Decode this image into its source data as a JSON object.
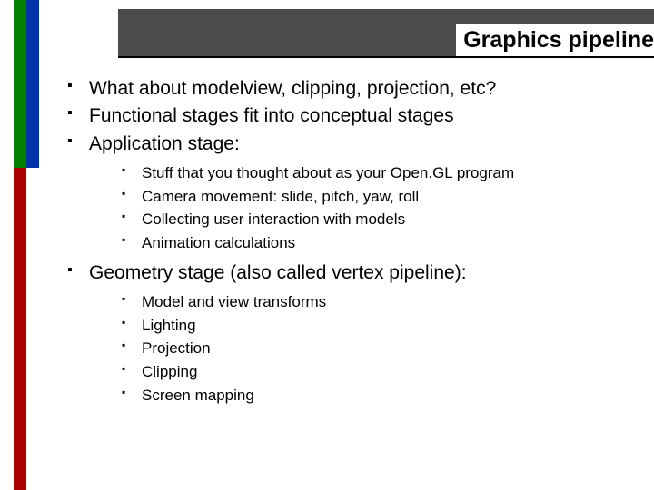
{
  "title": "Graphics pipeline",
  "bullets": {
    "l1": [
      "What about modelview, clipping, projection, etc?",
      "Functional stages fit into conceptual stages",
      "Application stage:",
      "Geometry stage (also called vertex pipeline):"
    ],
    "application_sub": [
      "Stuff that you thought about as your Open.GL program",
      "Camera movement: slide, pitch, yaw, roll",
      "Collecting user interaction with models",
      "Animation calculations"
    ],
    "geometry_sub": [
      "Model and view transforms",
      "Lighting",
      "Projection",
      "Clipping",
      "Screen mapping"
    ]
  }
}
